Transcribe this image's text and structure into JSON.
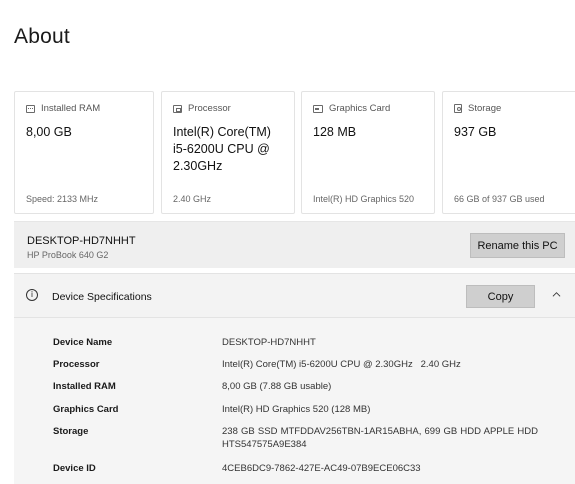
{
  "page": {
    "title": "About"
  },
  "cards": [
    {
      "icon": "ram-icon",
      "label": "Installed RAM",
      "value": "8,00 GB",
      "sub": "Speed: 2133 MHz"
    },
    {
      "icon": "processor-icon",
      "label": "Processor",
      "value": "Intel(R) Core(TM) i5-6200U CPU @ 2.30GHz",
      "sub": "2.40 GHz"
    },
    {
      "icon": "graphics-card-icon",
      "label": "Graphics Card",
      "value": "128 MB",
      "sub": "Intel(R) HD Graphics 520"
    },
    {
      "icon": "storage-icon",
      "label": "Storage",
      "value": "937 GB",
      "sub": "66 GB of 937 GB used"
    }
  ],
  "device": {
    "name": "DESKTOP-HD7NHHT",
    "model": "HP ProBook 640 G2",
    "rename_label": "Rename this PC"
  },
  "specs": {
    "header": "Device Specifications",
    "copy_label": "Copy",
    "rows": [
      {
        "key": "Device Name",
        "value": "DESKTOP-HD7NHHT"
      },
      {
        "key": "Processor",
        "value": "Intel(R) Core(TM) i5-6200U CPU @ 2.30GHz   2.40 GHz"
      },
      {
        "key": "Installed RAM",
        "value": "8,00 GB (7.88 GB usable)"
      },
      {
        "key": "Graphics Card",
        "value": "Intel(R) HD Graphics 520 (128 MB)"
      },
      {
        "key": "Storage",
        "value": "238 GB SSD MTFDDAV256TBN-1AR15ABHA, 699 GB HDD APPLE HDD HTS547575A9E384"
      },
      {
        "key": "Device ID",
        "value": "4CEB6DC9-7862-427E-AC49-07B9ECE06C33"
      }
    ]
  }
}
